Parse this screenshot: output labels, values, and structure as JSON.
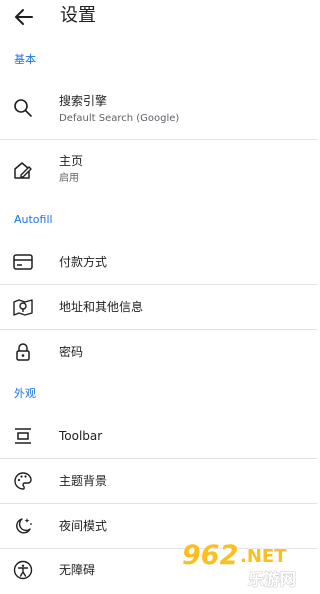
{
  "header": {
    "title": "设置",
    "back_icon": "arrow-left-icon"
  },
  "sections": {
    "basic": "基本",
    "autofill": "Autofill",
    "appearance": "外观"
  },
  "items": {
    "search_engine": {
      "label": "搜索引擎",
      "sub": "Default Search (Google)",
      "icon": "search-icon"
    },
    "homepage": {
      "label": "主页",
      "sub": "启用",
      "icon": "home-edit-icon"
    },
    "payment": {
      "label": "付款方式",
      "icon": "credit-card-icon"
    },
    "addresses": {
      "label": "地址和其他信息",
      "icon": "map-pin-icon"
    },
    "passwords": {
      "label": "密码",
      "icon": "lock-icon"
    },
    "toolbar": {
      "label": "Toolbar",
      "icon": "toolbar-icon"
    },
    "theme": {
      "label": "主题背景",
      "icon": "palette-icon"
    },
    "night_mode": {
      "label": "夜间模式",
      "icon": "moon-stars-icon"
    },
    "accessibility": {
      "label": "无障碍",
      "icon": "accessibility-icon"
    }
  },
  "watermark": {
    "number": "962",
    "suffix": "NET",
    "chinese": "乐游网"
  },
  "colors": {
    "accent": "#1a73e8",
    "divider": "#e2e2e2",
    "text": "#1f1f1f",
    "subtext": "#5f6368"
  }
}
